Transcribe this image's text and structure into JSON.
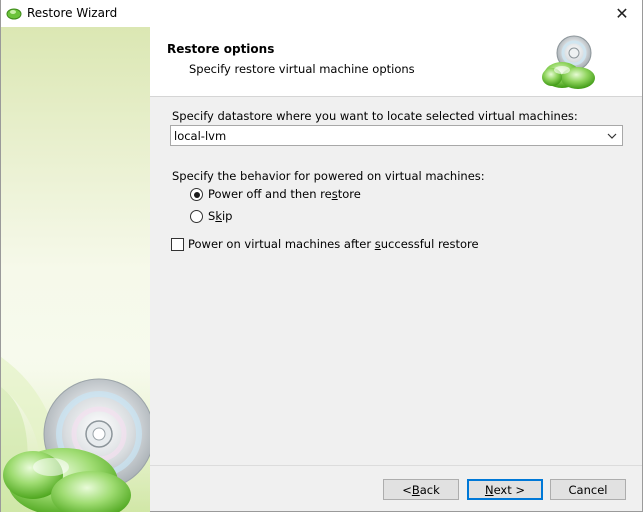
{
  "window": {
    "title": "Restore Wizard",
    "close_glyph": "✕"
  },
  "header": {
    "title": "Restore options",
    "subtitle": "Specify restore virtual machine options",
    "icon": "disc-cloud-icon"
  },
  "datastore": {
    "label": "Specify datastore where you want to locate selected virtual machines:",
    "selected": "local-lvm"
  },
  "behavior": {
    "label": "Specify the behavior for powered on virtual machines:",
    "options": [
      {
        "pre": "Power off and then re",
        "key": "s",
        "post": "tore",
        "checked": true
      },
      {
        "pre": "S",
        "key": "k",
        "post": "ip",
        "checked": false
      }
    ]
  },
  "power_on": {
    "pre": "Power on virtual machines after ",
    "key": "s",
    "post": "uccessful restore",
    "checked": false
  },
  "buttons": {
    "back": {
      "pre": "< ",
      "key": "B",
      "post": "ack"
    },
    "next": {
      "pre": "",
      "key": "N",
      "post": "ext >"
    },
    "cancel": {
      "label": "Cancel"
    }
  },
  "colors": {
    "accent": "#0078d7",
    "brand_green": "#5fb82a"
  }
}
